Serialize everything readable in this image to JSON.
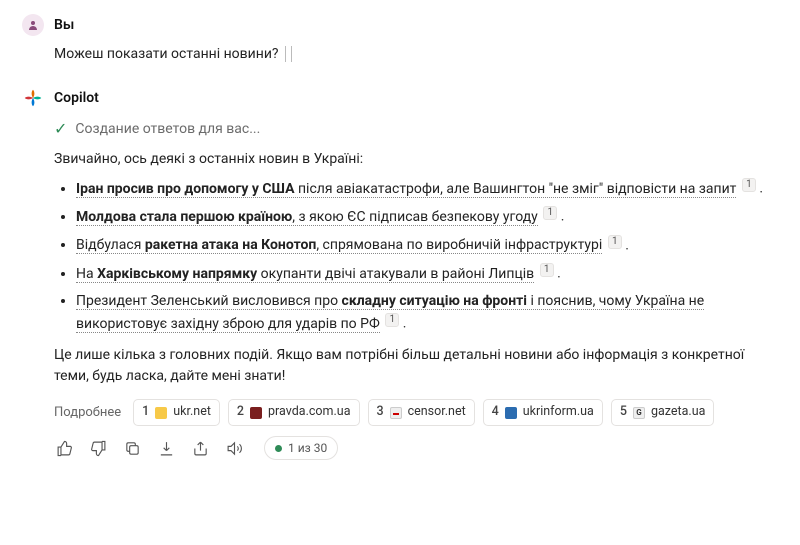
{
  "user": {
    "sender": "Вы",
    "message": "Можеш показати останні новини?"
  },
  "copilot": {
    "sender": "Copilot",
    "status": "Создание ответов для вас...",
    "intro": "Звичайно, ось деякі з останніх новин в Україні:",
    "news": [
      {
        "prefix": "",
        "bold": "Іран просив про допомогу у США",
        "rest": " після авіакатастрофи, але Вашингтон \"не зміг\" відповісти на запит",
        "cite": "1"
      },
      {
        "prefix": "",
        "bold": "Молдова стала першою країною",
        "rest": ", з якою ЄС підписав безпекову угоду",
        "cite": "1"
      },
      {
        "prefix": "Відбулася ",
        "bold": "ракетна атака на Конотоп",
        "rest": ", спрямована по виробничій інфраструктурі",
        "cite": "1"
      },
      {
        "prefix": "На ",
        "bold": "Харківському напрямку",
        "rest": " окупанти двічі атакували в районі Липців",
        "cite": "1"
      },
      {
        "prefix": "Президент Зеленський висловився про ",
        "bold": "складну ситуацію на фронті",
        "rest": " і пояснив, чому Україна не використовує західну зброю для ударів по РФ",
        "cite": "1"
      }
    ],
    "outro": "Це лише кілька з головних подій. Якщо вам потрібні більш детальні новини або інформація з конкретної теми, будь ласка, дайте мені знати!"
  },
  "sources": {
    "label": "Подробнее",
    "items": [
      {
        "num": "1",
        "name": "ukr.net",
        "icon": "ukrnet"
      },
      {
        "num": "2",
        "name": "pravda.com.ua",
        "icon": "pravda"
      },
      {
        "num": "3",
        "name": "censor.net",
        "icon": "censor"
      },
      {
        "num": "4",
        "name": "ukrinform.ua",
        "icon": "ukrinform"
      },
      {
        "num": "5",
        "name": "gazeta.ua",
        "icon": "gazeta"
      }
    ]
  },
  "footer": {
    "counter": "1 из 30"
  }
}
